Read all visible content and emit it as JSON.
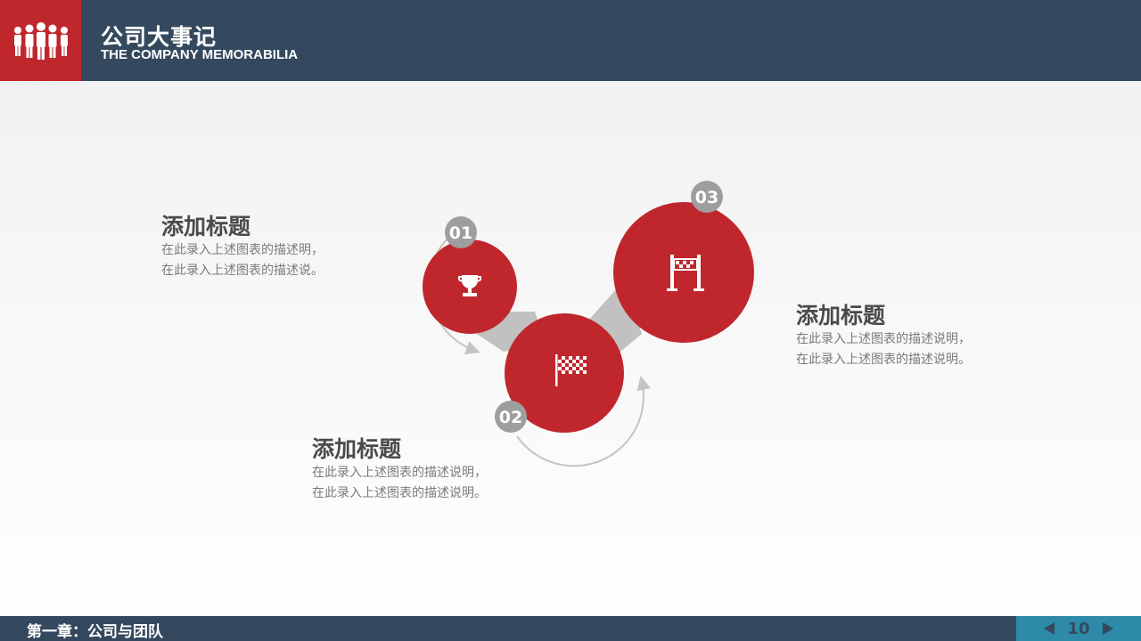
{
  "header": {
    "title_cn": "公司大事记",
    "title_en": "THE COMPANY MEMORABILIA",
    "logo_icon": "team-people-icon",
    "bar_color": "#34495e",
    "accent_color": "#c0272d"
  },
  "steps": [
    {
      "number": "01",
      "icon": "trophy-icon"
    },
    {
      "number": "02",
      "icon": "checkered-flag-icon"
    },
    {
      "number": "03",
      "icon": "finish-line-icon"
    }
  ],
  "blocks": [
    {
      "title": "添加标题",
      "lines": [
        "在此录入上述图表的描述明，",
        "在此录入上述图表的描述说。"
      ]
    },
    {
      "title": "添加标题",
      "lines": [
        "在此录入上述图表的描述说明，",
        "在此录入上述图表的描述说明。"
      ]
    },
    {
      "title": "添加标题",
      "lines": [
        "在此录入上述图表的描述说明，",
        "在此录入上述图表的描述说明。"
      ]
    }
  ],
  "footer": {
    "chapter": "第一章：公司与团队",
    "page": "10",
    "pager_color": "#2d8aa8"
  }
}
